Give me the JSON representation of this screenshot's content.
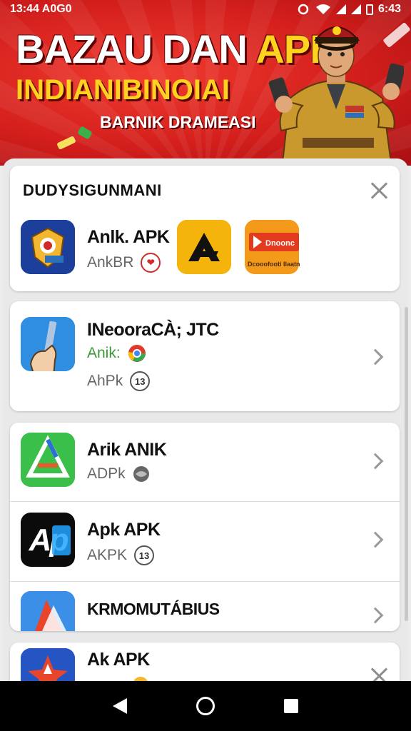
{
  "status_bar": {
    "time_left": "13:44 A0G0",
    "time_right": "6:43"
  },
  "banner": {
    "title_main": "BAZAU DAN ",
    "title_accent": "APK",
    "subtitle": "INDIANIBINOIAI",
    "tagline": "BARNIK DRAMEASI"
  },
  "card1": {
    "title": "DUDYSIGUNMANI",
    "app_name": "Anlk. APK",
    "app_meta": "AnkBR",
    "thumb2_label": "Dnoonc",
    "thumb2_caption": "Dcooofooti Ilaatn"
  },
  "card2": {
    "app_name": "INeooraCÀ; JTC",
    "meta1": "Anik:",
    "meta2": "AhPk",
    "meta2_badge": "13"
  },
  "card3": {
    "row1": {
      "name": "Arik ANIK",
      "meta": "ADPk"
    },
    "row2": {
      "name": "Apk APK",
      "meta": "AKPK",
      "badge": "13",
      "icon_text": "Ap"
    },
    "row3": {
      "name": "KRMOMUTÁBIUS"
    }
  },
  "card4": {
    "app_name": "Ak APK"
  },
  "colors": {
    "banner_red": "#d41f1c",
    "accent_yellow": "#ffd21f"
  },
  "icons": [
    "wifi-icon",
    "signal-icon",
    "battery-icon",
    "close-icon",
    "chevron-right-icon",
    "nav-back-icon",
    "nav-home-icon",
    "nav-recent-icon"
  ]
}
